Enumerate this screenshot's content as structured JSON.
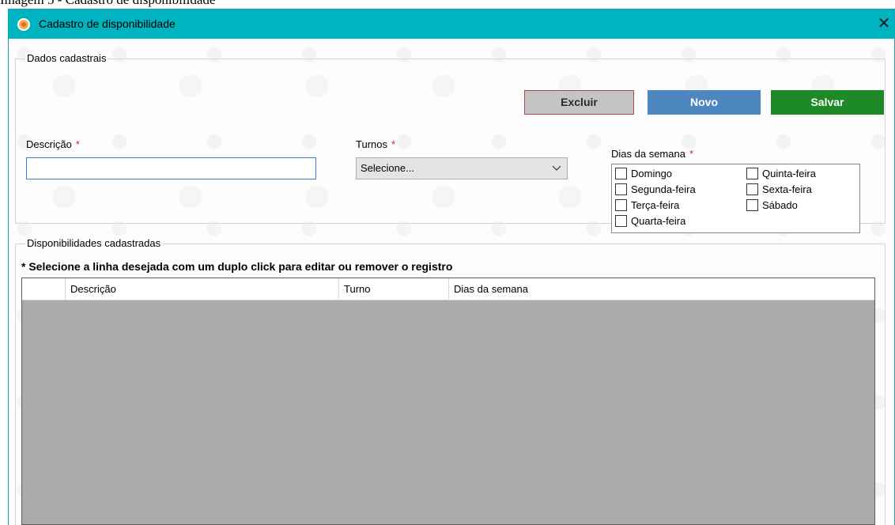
{
  "document": {
    "caption": "Imagem 5 - Cadastro de disponibilidade"
  },
  "window": {
    "title": "Cadastro de disponibilidade",
    "close_glyph": "✕",
    "icon": "app-icon"
  },
  "dados_cadastrais": {
    "group_title": "Dados cadastrais",
    "buttons": {
      "excluir": "Excluir",
      "novo": "Novo",
      "salvar": "Salvar"
    },
    "descricao": {
      "label": "Descrição",
      "required_mark": "*",
      "value": ""
    },
    "turnos": {
      "label": "Turnos",
      "required_mark": "*",
      "selected": "Selecione..."
    },
    "dias_semana": {
      "label": "Dias da semana",
      "required_mark": "*",
      "days": [
        {
          "label": "Domingo",
          "checked": false
        },
        {
          "label": "Segunda-feira",
          "checked": false
        },
        {
          "label": "Terça-feira",
          "checked": false
        },
        {
          "label": "Quarta-feira",
          "checked": false
        },
        {
          "label": "Quinta-feira",
          "checked": false
        },
        {
          "label": "Sexta-feira",
          "checked": false
        },
        {
          "label": "Sábado",
          "checked": false
        }
      ]
    }
  },
  "disponibilidades": {
    "group_title": "Disponibilidades cadastradas",
    "hint": "* Selecione a linha desejada com um duplo click para editar ou remover o registro",
    "columns": [
      "",
      "Descrição",
      "Turno",
      "Dias da semana"
    ],
    "rows": []
  },
  "colors": {
    "titlebar": "#00b3c0",
    "excluir_bg": "#c4c4c4",
    "excluir_border": "#b04848",
    "novo_bg": "#4e86bf",
    "salvar_bg": "#1e8a27",
    "required_mark": "#e02020",
    "grid_empty_bg": "#ababab"
  }
}
